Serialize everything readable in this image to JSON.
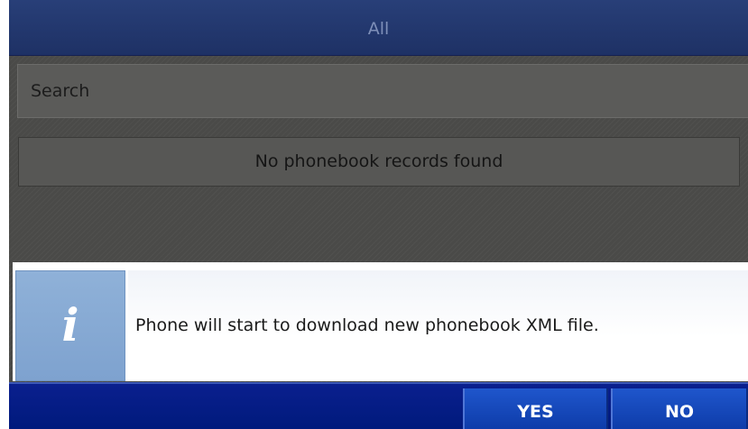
{
  "header": {
    "title": "All"
  },
  "search": {
    "placeholder": "Search"
  },
  "phonebook": {
    "empty_message": "No phonebook records found"
  },
  "dialog": {
    "icon": "info-icon",
    "icon_glyph": "i",
    "message": "Phone will start to download new phonebook XML file."
  },
  "softkeys": {
    "yes_label": "YES",
    "no_label": "NO"
  },
  "colors": {
    "header_bg": "#283f78",
    "softkey_bar_bg": "#0a1f8e",
    "softkey_bg": "#1f56cc",
    "info_icon_bg": "#8fb1d8"
  }
}
